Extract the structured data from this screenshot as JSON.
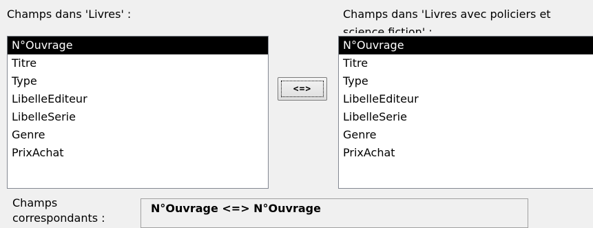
{
  "left_panel": {
    "label": "Champs dans 'Livres' :",
    "fields": [
      {
        "label": "N°Ouvrage",
        "selected": true
      },
      {
        "label": "Titre",
        "selected": false
      },
      {
        "label": "Type",
        "selected": false
      },
      {
        "label": "LibelleEditeur",
        "selected": false
      },
      {
        "label": "LibelleSerie",
        "selected": false
      },
      {
        "label": "Genre",
        "selected": false
      },
      {
        "label": "PrixAchat",
        "selected": false
      }
    ]
  },
  "right_panel": {
    "label": "Champs dans 'Livres avec policiers et science fiction' :",
    "fields": [
      {
        "label": "N°Ouvrage",
        "selected": true
      },
      {
        "label": "Titre",
        "selected": false
      },
      {
        "label": "Type",
        "selected": false
      },
      {
        "label": "LibelleEditeur",
        "selected": false
      },
      {
        "label": "LibelleSerie",
        "selected": false
      },
      {
        "label": "Genre",
        "selected": false
      },
      {
        "label": "PrixAchat",
        "selected": false
      }
    ]
  },
  "swap_button": {
    "label": "<=>"
  },
  "correspondence": {
    "label": "Champs correspondants :",
    "value": "N°Ouvrage <=> N°Ouvrage"
  }
}
